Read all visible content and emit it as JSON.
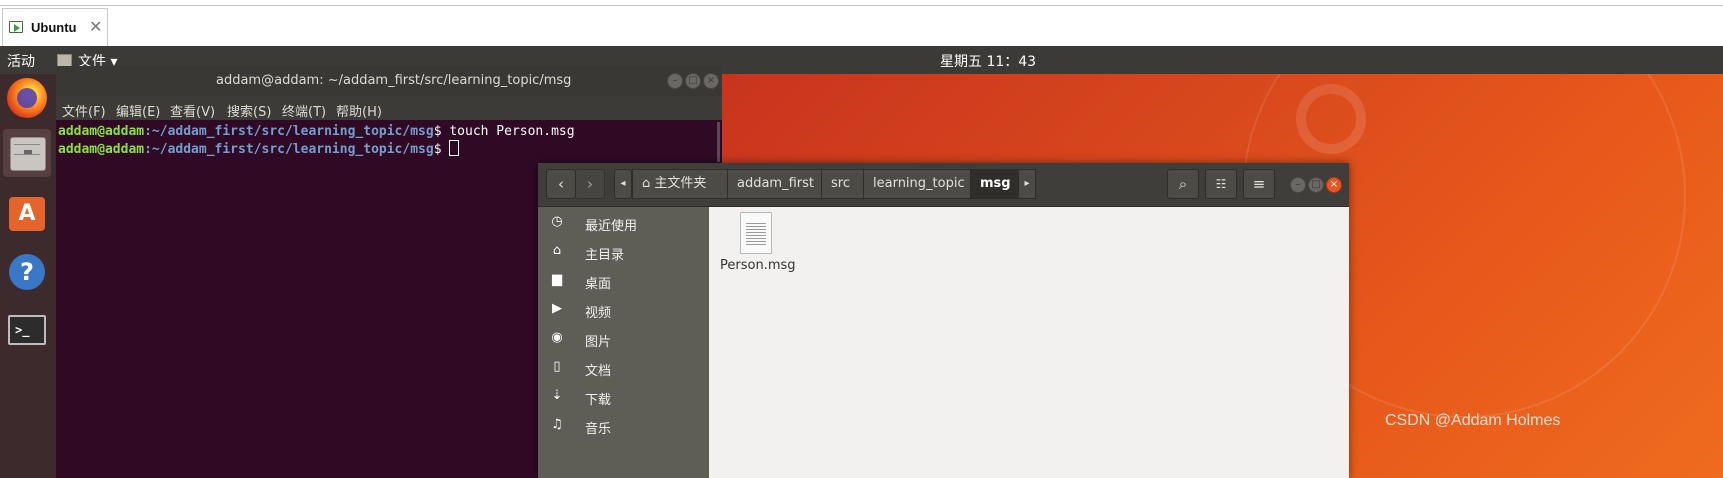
{
  "vm_tab": {
    "label": "Ubuntu",
    "close": "✕"
  },
  "topbar": {
    "activities": "活动",
    "app_menu": "文件 ▾",
    "clock": "星期五 11：43"
  },
  "dock": {
    "apps": [
      "firefox-icon",
      "files-icon",
      "software-center-icon",
      "help-icon",
      "terminal-icon"
    ]
  },
  "terminal": {
    "title": "addam@addam: ~/addam_first/src/learning_topic/msg",
    "menu": [
      "文件(F)",
      "编辑(E)",
      "查看(V)",
      "搜索(S)",
      "终端(T)",
      "帮助(H)"
    ],
    "lines": [
      {
        "user": "addam@addam",
        "path": ":~/addam_first/src/learning_topic/msg",
        "cmd": "$ touch Person.msg"
      },
      {
        "user": "addam@addam",
        "path": ":~/addam_first/src/learning_topic/msg",
        "cmd": "$ "
      }
    ]
  },
  "files": {
    "breadcrumbs": [
      "⌂ 主文件夹",
      "addam_first",
      "src",
      "learning_topic",
      "msg"
    ],
    "sidebar": [
      {
        "icon": "recent-icon",
        "glyph": "◷",
        "label": "最近使用"
      },
      {
        "icon": "home-icon",
        "glyph": "⌂",
        "label": "主目录"
      },
      {
        "icon": "desktop-icon",
        "glyph": "▆",
        "label": "桌面"
      },
      {
        "icon": "video-icon",
        "glyph": "▶",
        "label": "视频"
      },
      {
        "icon": "camera-icon",
        "glyph": "◉",
        "label": "图片"
      },
      {
        "icon": "document-icon",
        "glyph": "▯",
        "label": "文档"
      },
      {
        "icon": "download-icon",
        "glyph": "⇣",
        "label": "下载"
      },
      {
        "icon": "music-icon",
        "glyph": "♫",
        "label": "音乐"
      }
    ],
    "items": [
      {
        "name": "Person.msg",
        "icon": "text-file-icon"
      }
    ]
  },
  "watermark": "CSDN @Addam Holmes"
}
